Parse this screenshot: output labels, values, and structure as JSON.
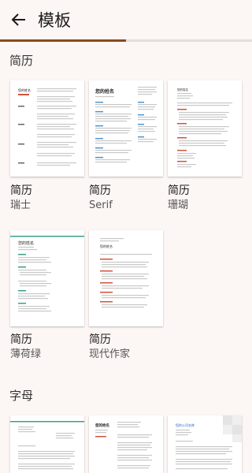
{
  "header": {
    "title": "模板",
    "back_icon": "arrow-left-icon"
  },
  "progress": {
    "value": 0.5,
    "color": "#8b4a1a"
  },
  "sections": [
    {
      "title": "简历",
      "templates": [
        {
          "kind": "简历",
          "name": "瑞士",
          "preview_name": "您的姓名"
        },
        {
          "kind": "简历",
          "name": "Serif",
          "preview_name": "您的姓名"
        },
        {
          "kind": "简历",
          "name": "珊瑚",
          "preview_name": "您的姓名"
        },
        {
          "kind": "简历",
          "name": "薄荷绿",
          "preview_name": "您的姓名"
        },
        {
          "kind": "简历",
          "name": "现代作家",
          "preview_name": "您的姓名"
        }
      ]
    },
    {
      "title": "字母",
      "templates": [
        {
          "name": ""
        },
        {
          "name": "",
          "preview_name": "您的姓名"
        },
        {
          "name": "",
          "preview_name": "您的公司名称"
        }
      ]
    }
  ],
  "colors": {
    "accent_red": "#d3523d",
    "accent_teal": "#3a9e8a",
    "accent_blue": "#4a90c8"
  }
}
